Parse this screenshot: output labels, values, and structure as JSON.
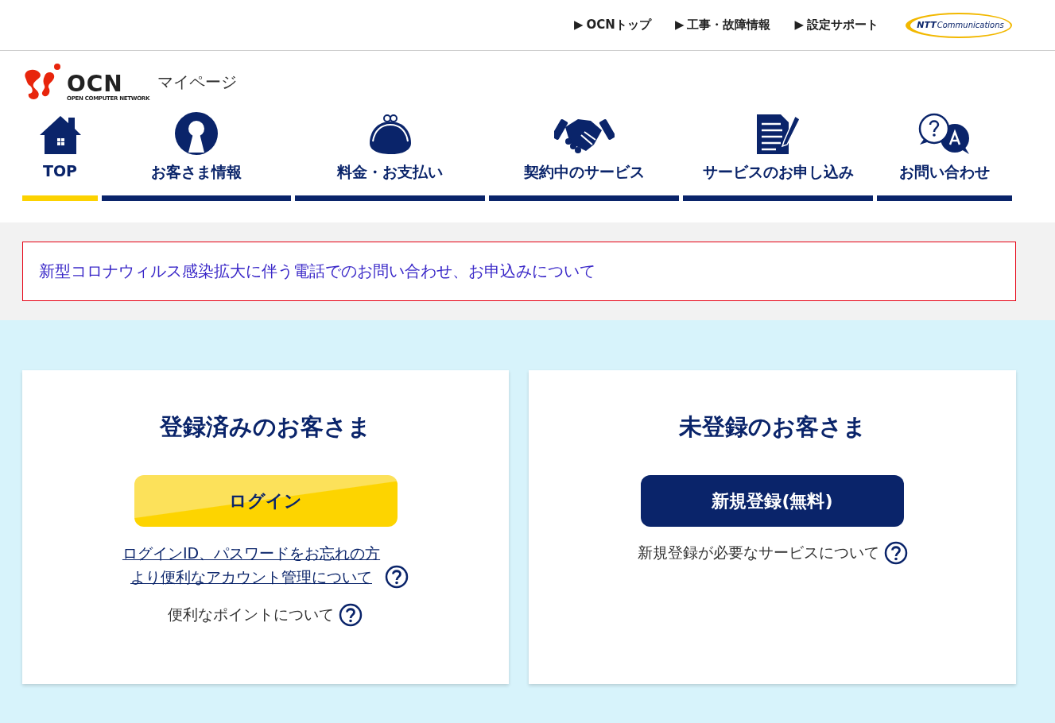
{
  "top_links": [
    {
      "arrow": "▶",
      "label": "OCNトップ"
    },
    {
      "arrow": "▶",
      "label": "工事・故障情報"
    },
    {
      "arrow": "▶",
      "label": "設定サポート"
    }
  ],
  "ntt_logo": {
    "brand": "NTT",
    "suffix": "Communications"
  },
  "logo": {
    "text": "OCN",
    "tagline": "OPEN COMPUTER NETWORK",
    "page_title": "マイページ"
  },
  "nav": [
    {
      "kind": "home",
      "label": "TOP",
      "selected": true
    },
    {
      "kind": "user",
      "label": "お客さま情報",
      "selected": false
    },
    {
      "kind": "purse",
      "label": "料金・お支払い",
      "selected": false
    },
    {
      "kind": "handshake",
      "label": "契約中のサービス",
      "selected": false
    },
    {
      "kind": "document",
      "label": "サービスのお申し込み",
      "selected": false
    },
    {
      "kind": "qa",
      "label": "お問い合わせ",
      "selected": false
    }
  ],
  "notice": {
    "link": "新型コロナウィルス感染拡大に伴う電話でのお問い合わせ、お申込みについて"
  },
  "cards": [
    {
      "kind": "login",
      "title": "登録済みのお客さま",
      "button": "ログイン",
      "links": [
        {
          "kind": "link",
          "lines": [
            "ログインID、パスワードをお忘れの方",
            "より便利なアカウント管理について"
          ]
        },
        {
          "kind": "text",
          "lines": [
            "便利なポイントについて"
          ]
        }
      ]
    },
    {
      "kind": "register",
      "title": "未登録のお客さま",
      "button": "新規登録(無料)",
      "links": [
        {
          "kind": "text",
          "lines": [
            "新規登録が必要なサービスについて"
          ]
        }
      ]
    }
  ]
}
